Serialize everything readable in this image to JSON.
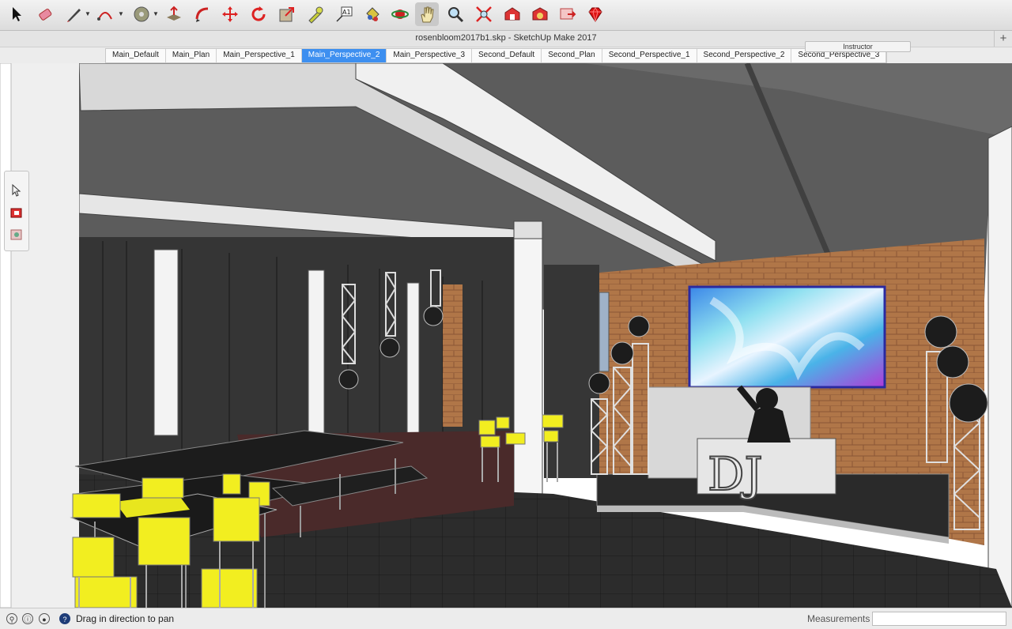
{
  "app": {
    "window_title": "rosenbloom2017b1.skp - SketchUp Make 2017",
    "instructor_label": "Instructor",
    "new_tab_label": "+"
  },
  "toolbar": {
    "tools": [
      {
        "name": "select-tool-icon",
        "icon": "arrow",
        "selected": false
      },
      {
        "name": "eraser-tool-icon",
        "icon": "eraser",
        "selected": false
      },
      {
        "name": "line-tool-icon",
        "icon": "pencil",
        "selected": false,
        "has_dropdown": true
      },
      {
        "name": "arc-tool-icon",
        "icon": "arc",
        "selected": false,
        "has_dropdown": true
      },
      {
        "name": "circle-tool-icon",
        "icon": "circle",
        "selected": false,
        "has_dropdown": true
      },
      {
        "name": "push-pull-tool-icon",
        "icon": "push-pull",
        "selected": false
      },
      {
        "name": "follow-me-tool-icon",
        "icon": "follow-me",
        "selected": false
      },
      {
        "name": "move-tool-icon",
        "icon": "move",
        "selected": false
      },
      {
        "name": "rotate-tool-icon",
        "icon": "rotate",
        "selected": false
      },
      {
        "name": "scale-tool-icon",
        "icon": "scale",
        "selected": false
      },
      {
        "name": "tape-measure-tool-icon",
        "icon": "tape",
        "selected": false
      },
      {
        "name": "text-tool-icon",
        "icon": "text",
        "selected": false
      },
      {
        "name": "paint-bucket-tool-icon",
        "icon": "paint",
        "selected": false
      },
      {
        "name": "orbit-tool-icon",
        "icon": "orbit",
        "selected": false
      },
      {
        "name": "pan-tool-icon",
        "icon": "hand",
        "selected": true
      },
      {
        "name": "zoom-tool-icon",
        "icon": "zoom",
        "selected": false
      },
      {
        "name": "zoom-extents-tool-icon",
        "icon": "zoom-extents",
        "selected": false
      },
      {
        "name": "warehouse-icon",
        "icon": "warehouse",
        "selected": false
      },
      {
        "name": "extension-warehouse-icon",
        "icon": "extension",
        "selected": false
      },
      {
        "name": "send-to-layout-icon",
        "icon": "layout",
        "selected": false
      },
      {
        "name": "ruby-console-icon",
        "icon": "ruby",
        "selected": false
      }
    ]
  },
  "scene_tabs": [
    {
      "label": "Main_Default",
      "active": false
    },
    {
      "label": "Main_Plan",
      "active": false
    },
    {
      "label": "Main_Perspective_1",
      "active": false
    },
    {
      "label": "Main_Perspective_2",
      "active": true
    },
    {
      "label": "Main_Perspective_3",
      "active": false
    },
    {
      "label": "Second_Default",
      "active": false
    },
    {
      "label": "Second_Plan",
      "active": false
    },
    {
      "label": "Second_Perspective_1",
      "active": false
    },
    {
      "label": "Second_Perspective_2",
      "active": false
    },
    {
      "label": "Second_Perspective_3",
      "active": false
    }
  ],
  "side_toolbar": {
    "tools": [
      {
        "name": "select-lasso-icon"
      },
      {
        "name": "make-component-icon"
      },
      {
        "name": "paint-material-icon"
      }
    ]
  },
  "viewport": {
    "dj_booth_text": "DJ",
    "colors": {
      "ceiling": "#5f5f5f",
      "beam": "#efefef",
      "brick": "#b07648",
      "floor": "#2d2d2d",
      "curtain": "#3a3a3a",
      "chair": "#f2ee20",
      "led_screen": "#62c7e8"
    }
  },
  "statusbar": {
    "hint": "Drag in direction to pan",
    "measurements_label": "Measurements",
    "measurements_value": ""
  }
}
